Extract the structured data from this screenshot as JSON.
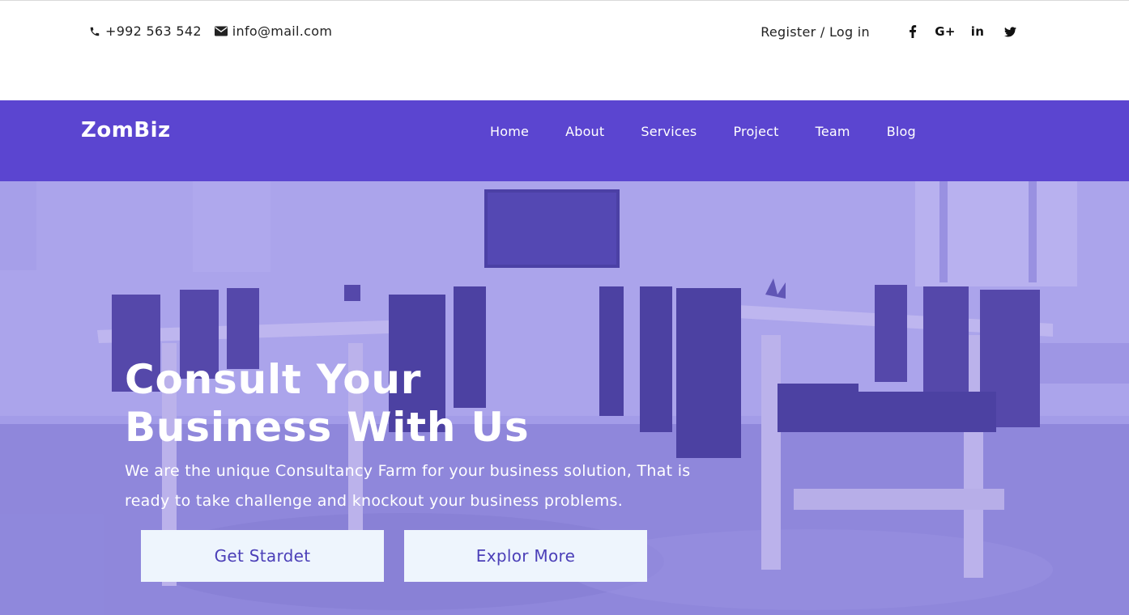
{
  "topbar": {
    "phone": "+992 563 542",
    "email": "info@mail.com",
    "auth_label": "Register / Log in",
    "social": [
      {
        "icon": "facebook-icon",
        "glyph": "f"
      },
      {
        "icon": "google-plus-icon",
        "glyph": "G+"
      },
      {
        "icon": "linkedin-icon",
        "glyph": "in"
      },
      {
        "icon": "twitter-icon",
        "glyph": "🐦"
      }
    ]
  },
  "navbar": {
    "logo": "ZomBiz",
    "items": [
      "Home",
      "About",
      "Services",
      "Project",
      "Team",
      "Blog"
    ]
  },
  "hero": {
    "title_line1": "Consult Your",
    "title_line2": "Business With Us",
    "text": "We are the unique Consultancy Farm for your business solution, That is ready to take challenge and knockout your business problems.",
    "button_primary": "Get Stardet",
    "button_secondary": "Explor More"
  },
  "colors": {
    "nav_bg": "#5b45d0",
    "button_bg": "#eef5fd",
    "button_text": "#4b3fb8"
  }
}
